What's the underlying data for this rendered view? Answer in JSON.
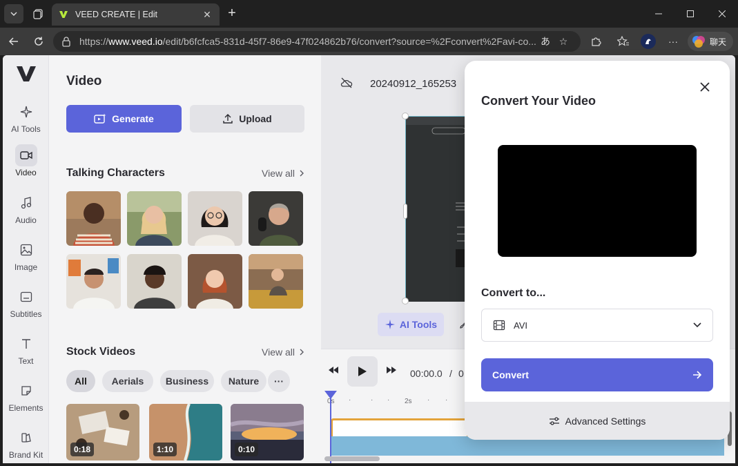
{
  "browser": {
    "tab_title": "VEED CREATE | Edit",
    "url_prefix": "https://",
    "url_host": "www.veed.io",
    "url_rest": "/edit/b6fcfca5-831d-45f7-86e9-47f024862b76/convert?source=%2Fconvert%2Favi-co...",
    "copilot_label": "聊天"
  },
  "rail": {
    "items": [
      {
        "label": "AI Tools",
        "icon": "sparkle-icon"
      },
      {
        "label": "Video",
        "icon": "video-icon"
      },
      {
        "label": "Audio",
        "icon": "music-note-icon"
      },
      {
        "label": "Image",
        "icon": "image-icon"
      },
      {
        "label": "Subtitles",
        "icon": "subtitles-icon"
      },
      {
        "label": "Text",
        "icon": "text-icon"
      },
      {
        "label": "Elements",
        "icon": "elements-icon"
      },
      {
        "label": "Brand Kit",
        "icon": "brand-kit-icon"
      }
    ]
  },
  "panel": {
    "title": "Video",
    "generate_label": "Generate",
    "upload_label": "Upload",
    "talking_title": "Talking Characters",
    "stock_title": "Stock Videos",
    "view_all": "View all",
    "chips": [
      "All",
      "Aerials",
      "Business",
      "Nature"
    ],
    "stock_durations": [
      "0:18",
      "1:10",
      "0:10"
    ]
  },
  "editor": {
    "project_name": "20240912_165253",
    "ai_tools_label": "AI Tools",
    "time_current": "00:00.0",
    "time_sep": "/",
    "time_total": "0:",
    "ruler": [
      "0s",
      "2s"
    ]
  },
  "modal": {
    "title": "Convert Your Video",
    "convert_to_label": "Convert to...",
    "format_value": "AVI",
    "convert_button": "Convert",
    "advanced_label": "Advanced Settings"
  }
}
